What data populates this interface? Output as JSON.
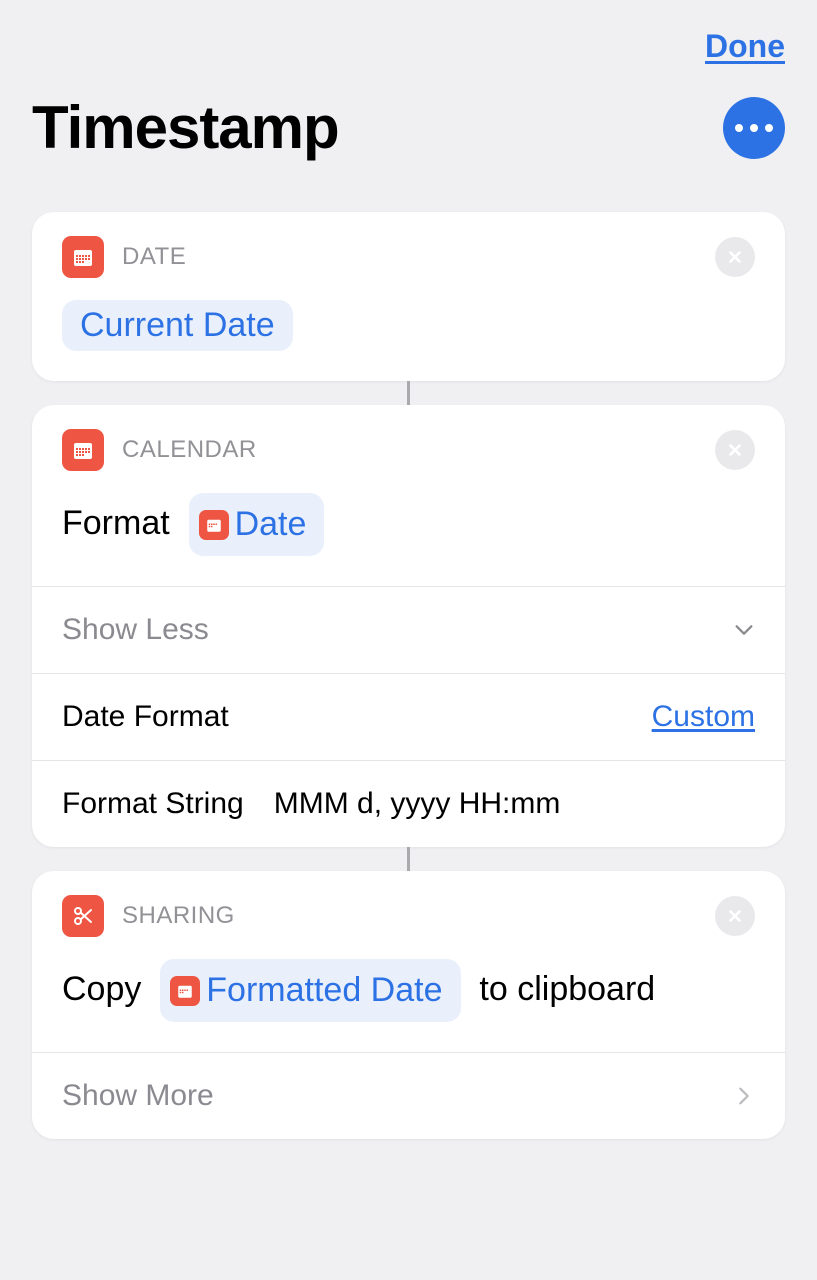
{
  "header": {
    "done_label": "Done",
    "title": "Timestamp"
  },
  "actions": [
    {
      "category": "DATE",
      "token": "Current Date"
    },
    {
      "category": "CALENDAR",
      "action_prefix": "Format",
      "token": "Date",
      "expand_label": "Show Less",
      "date_format_label": "Date Format",
      "date_format_value": "Custom",
      "format_string_label": "Format String",
      "format_string_value": "MMM d, yyyy HH:mm"
    },
    {
      "category": "SHARING",
      "action_prefix": "Copy",
      "token": "Formatted Date",
      "action_suffix": "to clipboard",
      "expand_label": "Show More"
    }
  ]
}
